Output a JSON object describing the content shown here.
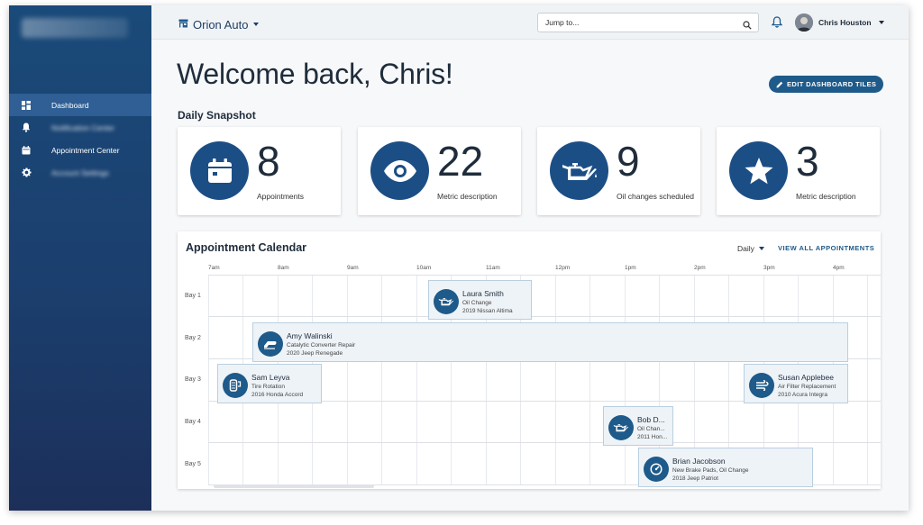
{
  "sidebar": {
    "logo_text": "ShopWatch",
    "items": [
      {
        "label": "Dashboard",
        "icon": "dashboard-icon"
      },
      {
        "label": "Notification Center",
        "icon": "bell-icon"
      },
      {
        "label": "Appointment Center",
        "icon": "calendar-icon"
      },
      {
        "label": "Account Settings",
        "icon": "gear-icon"
      }
    ]
  },
  "header": {
    "org_name": "Orion Auto",
    "search_placeholder": "Jump to...",
    "user_name": "Chris Houston"
  },
  "main": {
    "welcome": "Welcome back, Chris!",
    "edit_button": "EDIT DASHBOARD TILES",
    "snapshot_title": "Daily Snapshot",
    "tiles": [
      {
        "value": "8",
        "label": "Appointments",
        "icon": "calendar-icon"
      },
      {
        "value": "22",
        "label": "Metric description",
        "icon": "eye-icon"
      },
      {
        "value": "9",
        "label": "Oil changes scheduled",
        "icon": "oil-can-icon"
      },
      {
        "value": "3",
        "label": "Metric description",
        "icon": "star-icon"
      }
    ]
  },
  "calendar": {
    "title": "Appointment Calendar",
    "view": "Daily",
    "view_all": "VIEW ALL APPOINTMENTS",
    "times": [
      "7am",
      "8am",
      "9am",
      "10am",
      "11am",
      "12pm",
      "1pm",
      "2pm",
      "3pm",
      "4pm"
    ],
    "bays": [
      "Bay 1",
      "Bay 2",
      "Bay 3",
      "Bay 4",
      "Bay 5"
    ],
    "appointments": [
      {
        "name": "Laura Smith",
        "service": "Oil Change",
        "vehicle": "2019 Nissan Altima",
        "icon": "oil-can-icon"
      },
      {
        "name": "Amy Walinski",
        "service": "Catalytic Converter Repair",
        "vehicle": "2020 Jeep Renegade",
        "icon": "exhaust-icon"
      },
      {
        "name": "Sam Leyva",
        "service": "Tire Rotation",
        "vehicle": "2016 Honda Accord",
        "icon": "tire-icon"
      },
      {
        "name": "Susan Applebee",
        "service": "Air Filter Replacement",
        "vehicle": "2010 Acura Integra",
        "icon": "air-filter-icon"
      },
      {
        "name": "Bob D...",
        "service": "Oil Chan...",
        "vehicle": "2011 Hon...",
        "icon": "oil-can-icon"
      },
      {
        "name": "Brian Jacobson",
        "service": "New Brake Pads, Oil Change",
        "vehicle": "2018 Jeep Patriot",
        "icon": "brake-gauge-icon"
      }
    ]
  },
  "colors": {
    "sidebar": "#1b3f6e",
    "accent": "#1e5a8a",
    "tile_icon_bg": "#1c4e86",
    "appointment_bg": "#eef3f7"
  }
}
